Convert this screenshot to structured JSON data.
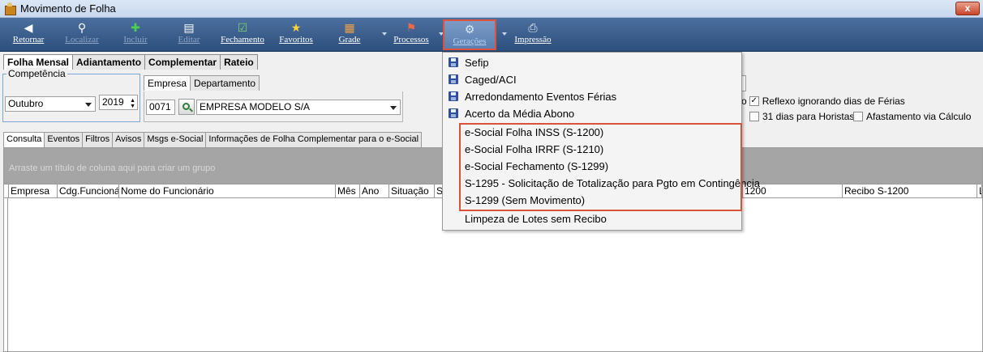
{
  "window": {
    "title": "Movimento de Folha",
    "close": "x"
  },
  "toolbar": {
    "buttons": [
      {
        "label": "Retornar",
        "icon": "back-icon"
      },
      {
        "label": "Localizar",
        "icon": "magnifier-icon"
      },
      {
        "label": "Incluir",
        "icon": "plus-icon"
      },
      {
        "label": "Editar",
        "icon": "edit-icon"
      },
      {
        "label": "Fechamento",
        "icon": "checklist-icon"
      },
      {
        "label": "Favoritos",
        "icon": "star-icon"
      },
      {
        "label": "Grade",
        "icon": "grid-icon"
      },
      {
        "label": "Processos",
        "icon": "process-icon"
      },
      {
        "label": "Gerações",
        "icon": "gear-icon"
      },
      {
        "label": "Impressão",
        "icon": "printer-icon"
      }
    ]
  },
  "main_tabs": [
    "Folha Mensal",
    "Adiantamento",
    "Complementar",
    "Rateio"
  ],
  "competencia": {
    "legend": "Competência",
    "month": "Outubro",
    "year": "2019"
  },
  "empresa": {
    "tabs": [
      "Empresa",
      "Departamento"
    ],
    "code": "0071",
    "name": "EMPRESA MODELO S/A"
  },
  "options": {
    "partial_prefix": "o",
    "reflexo": "Reflexo ignorando dias de Férias",
    "dias_horistas": "31 dias para Horistas",
    "afastamento": "Afastamento via Cálculo"
  },
  "sub_tabs": [
    "Consulta",
    "Eventos",
    "Filtros",
    "Avisos",
    "Msgs e-Social",
    "Informações de Folha Complementar para o e-Social"
  ],
  "grid": {
    "group_hint": "Arraste um título de coluna aqui para criar um grupo",
    "columns": [
      "Empresa",
      "Cdg.Funcionário",
      "Nome do Funcionário",
      "Mês",
      "Ano",
      "Situação",
      "S",
      "1200",
      "Recibo S-1200",
      "L"
    ]
  },
  "geracoes_menu": {
    "items": [
      "Sefip",
      "Caged/ACI",
      "Arredondamento Eventos Férias",
      "Acerto da Média Abono",
      "e-Social Folha INSS (S-1200)",
      "e-Social Folha IRRF (S-1210)",
      "e-Social Fechamento (S-1299)",
      "S-1295 - Solicitação de Totalização para Pgto em Contingência",
      "S-1299 (Sem Movimento)",
      "Limpeza de Lotes sem Recibo"
    ]
  },
  "colors": {
    "toolbar": "#3a5d8c",
    "highlight": "#d9533b",
    "disk_icon": "#2f4fa0"
  }
}
